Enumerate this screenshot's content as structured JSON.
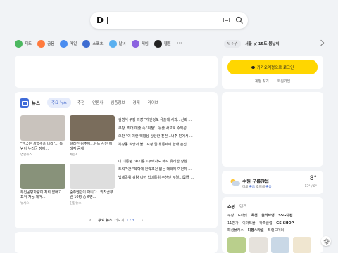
{
  "search": {
    "placeholder": ""
  },
  "shortcuts": [
    {
      "label": "지도",
      "color": "#4cb860"
    },
    {
      "label": "금융",
      "color": "#ff7a3d"
    },
    {
      "label": "메일",
      "color": "#4b8df0"
    },
    {
      "label": "스포츠",
      "color": "#3d6cd1"
    },
    {
      "label": "날씨",
      "color": "#5ab0f0"
    },
    {
      "label": "게임",
      "color": "#8b63e0"
    },
    {
      "label": "웹툰",
      "color": "#222222"
    }
  ],
  "top_right": {
    "ai_badge": "AI 이슈",
    "weather_text": "서울 낮 15도 봄날씨"
  },
  "login": {
    "button": "카카오계정으로 로그인",
    "find": "계정 찾기",
    "join": "회원가입"
  },
  "news": {
    "title": "뉴스",
    "tabs": [
      "주요 뉴스",
      "추천",
      "언론사",
      "심층정보",
      "경제",
      "라이브"
    ],
    "thumbs": [
      {
        "title": "\"한국은 심형수술 나라\"... 통념아 누리군 장애...",
        "source": "연합뉴스",
        "color": "#c9c3bd"
      },
      {
        "title": "달라진 김주애...단독 사진 이례적 공개",
        "source": "채널A",
        "color": "#7a6d5c"
      },
      {
        "title": "무인공병차량이 지뢰 없애고 표적 자동 제거...",
        "source": "뉴시스",
        "color": "#88927a"
      },
      {
        "title": "중주엔만이 아니다...외직급무원 10명 중 6명...",
        "source": "연합뉴스",
        "color": "#dedede"
      }
    ],
    "headlines": [
      "김범석 쿠팡 의장 \"개인정보 유출에 사과...신뢰 ...",
      "쿠팡, 최대 매출 속 '휘청'...유출 사고로 수익성 ...",
      "오만 \"이 이란 핵협상 상당한 진전...내주 빈에서 ...",
      "북창동 식당서 불...시청 일대 통제에 한때 혼잡",
      "이 대통령 \"후기용 1주택자도 매각 유리한 상황...",
      "트럭박관 \"북학에 전략조건 없는 대화에 여전히 ...",
      "법제곡위 김람 이어 법미통위 추천인 부결...與野 ..."
    ],
    "pager": {
      "label": "주요 뉴스",
      "more": "더보기",
      "count": "1 / 3"
    }
  },
  "weather": {
    "title": "수원 구름많음",
    "sub1": "미세",
    "sub1_val": "좋음",
    "sub2": "초미세",
    "sub2_val": "좋음",
    "temp": "8°",
    "range": "13° / 8°"
  },
  "shopping": {
    "title": "쇼핑",
    "sub": "렌즈",
    "rows": [
      [
        {
          "t": "쿠팡",
          "b": false
        },
        {
          "t": "G마켓",
          "b": false
        },
        {
          "t": "옥션",
          "b": true
        },
        {
          "t": "올리브영",
          "b": true
        },
        {
          "t": "SSG닷컴",
          "b": true
        }
      ],
      [
        {
          "t": "11번가",
          "b": false
        },
        {
          "t": "이마트몰",
          "b": false
        },
        {
          "t": "하프클럽",
          "b": false
        },
        {
          "t": "GS SHOP",
          "b": true
        }
      ],
      [
        {
          "t": "패션플러스",
          "b": false
        },
        {
          "t": "디펜스타일",
          "b": true
        },
        {
          "t": "트랜드데이",
          "b": false
        }
      ]
    ],
    "thumb_colors": [
      "#b9cf8c",
      "#e6e2dc",
      "#c9d8e6",
      "#f0e6d0"
    ]
  },
  "colors": {
    "accent": "#ffd600",
    "news_blue": "#3960c9"
  }
}
